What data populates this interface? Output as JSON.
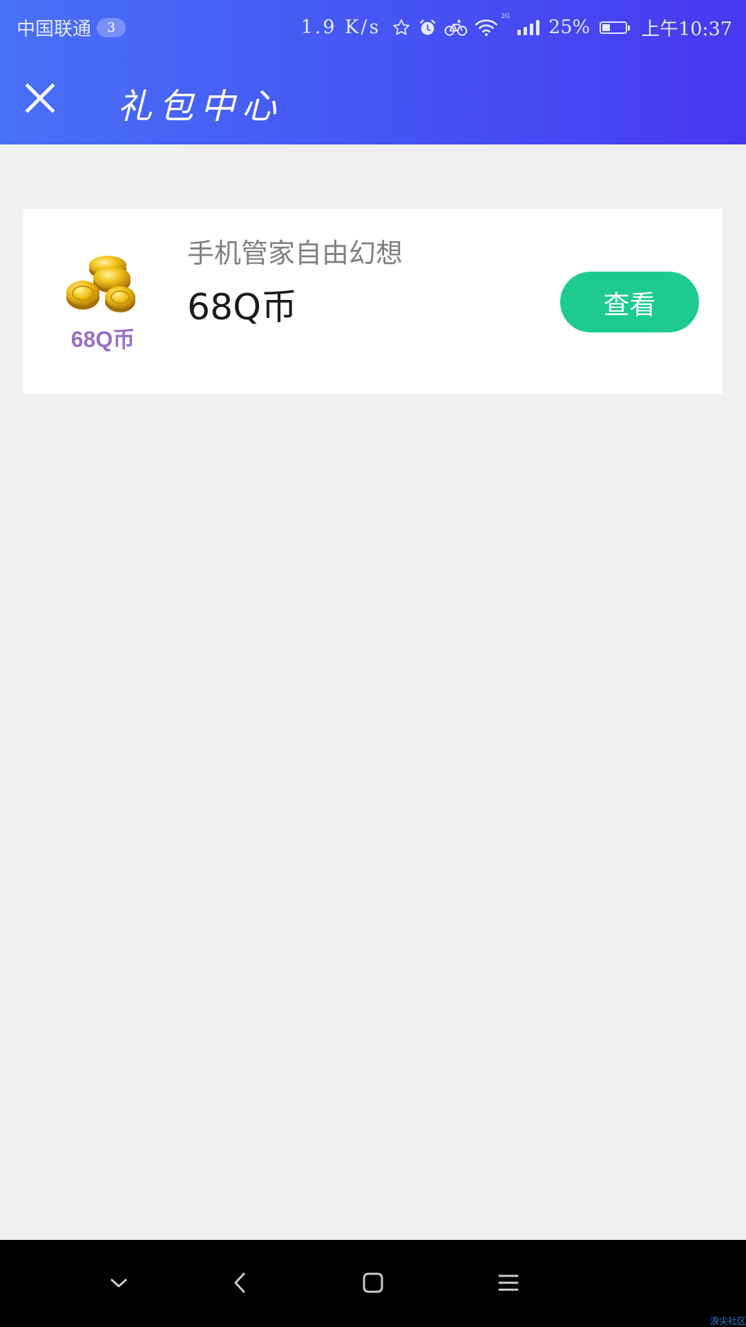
{
  "status_bar": {
    "carrier": "中国联通",
    "notification_count": "3",
    "net_speed": "1.9 K/s",
    "network_gen": "2G",
    "battery_percent": "25%",
    "battery_level": 0.25,
    "time": "上午10:37",
    "icons": [
      "star-outline-icon",
      "alarm-icon",
      "bike-icon",
      "wifi-icon",
      "signal-icon",
      "battery-icon"
    ]
  },
  "app_bar": {
    "close_icon": "close-icon",
    "title": "礼包中心"
  },
  "gift_list": [
    {
      "thumbnail_label": "68Q币",
      "thumbnail_icon": "gold-coins-icon",
      "title": "手机管家自由幻想",
      "amount": "68Q币",
      "action_label": "查看"
    }
  ],
  "nav_bar": {
    "icons": [
      "chevron-down-icon",
      "back-icon",
      "home-icon",
      "menu-icon"
    ]
  },
  "watermark": "浪尖社区",
  "colors": {
    "header_gradient_start": "#4870f6",
    "header_gradient_end": "#4838ef",
    "page_background": "#f0f0f0",
    "action_button": "#1dcb92",
    "thumbnail_label": "#9a6fc5",
    "title_gray": "#808080"
  }
}
